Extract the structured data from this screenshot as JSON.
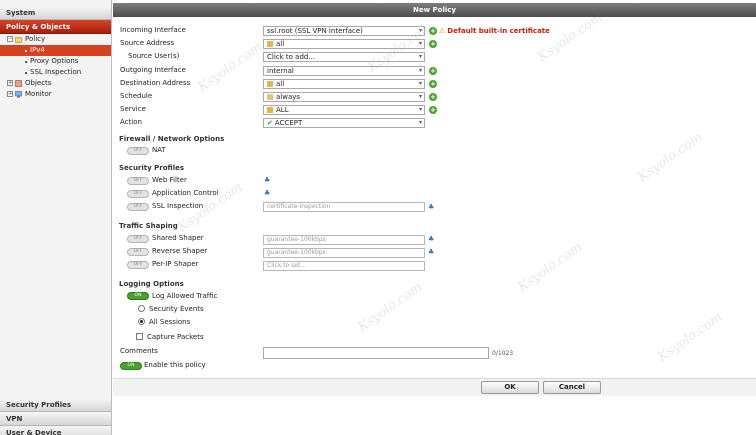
{
  "sidebar": {
    "system": "System",
    "policy_objects": "Policy & Objects",
    "tree": {
      "policy": "Policy",
      "ipv4": "IPv4",
      "proxy_options": "Proxy Options",
      "ssl_inspection": "SSL Inspection",
      "objects": "Objects",
      "monitor": "Monitor"
    },
    "security_profiles": "Security Profiles",
    "vpn": "VPN",
    "user_device": "User & Device"
  },
  "dialog": {
    "title": "New Policy",
    "fields": {
      "incoming_interface": {
        "label": "Incoming Interface",
        "value": "ssl.root (SSL VPN interface)",
        "warning": "Default built-in certificate"
      },
      "source_address": {
        "label": "Source Address",
        "value": "all"
      },
      "source_users": {
        "label": "Source User(s)",
        "value": "Click to add..."
      },
      "outgoing_interface": {
        "label": "Outgoing Interface",
        "value": "internal"
      },
      "destination_address": {
        "label": "Destination Address",
        "value": "all"
      },
      "schedule": {
        "label": "Schedule",
        "value": "always"
      },
      "service": {
        "label": "Service",
        "value": "ALL"
      },
      "action": {
        "label": "Action",
        "value": "ACCEPT"
      }
    },
    "firewall": {
      "title": "Firewall / Network Options",
      "nat": {
        "label": "NAT",
        "state": "OFF"
      }
    },
    "security_profiles": {
      "title": "Security Profiles",
      "web_filter": {
        "label": "Web Filter",
        "state": "OFF"
      },
      "application_control": {
        "label": "Application Control",
        "state": "OFF"
      },
      "ssl_inspection": {
        "label": "SSL Inspection",
        "state": "OFF",
        "value": "certificate-inspection"
      }
    },
    "traffic_shaping": {
      "title": "Traffic Shaping",
      "shared_shaper": {
        "label": "Shared Shaper",
        "state": "OFF",
        "value": "guarantee-100kbps"
      },
      "reverse_shaper": {
        "label": "Reverse Shaper",
        "state": "OFF",
        "value": "guarantee-100kbps"
      },
      "per_ip_shaper": {
        "label": "Per-IP Shaper",
        "state": "OFF",
        "value": "Click to set..."
      }
    },
    "logging": {
      "title": "Logging Options",
      "log_allowed": {
        "label": "Log Allowed Traffic",
        "state": "ON"
      },
      "security_events": "Security Events",
      "all_sessions": "All Sessions",
      "capture_packets": "Capture Packets"
    },
    "comments": {
      "label": "Comments",
      "counter": "0/1023"
    },
    "enable_policy": {
      "label": "Enable this policy",
      "state": "ON"
    },
    "buttons": {
      "ok": "OK",
      "cancel": "Cancel"
    }
  },
  "watermark": "Ksyolo.com",
  "colors": {
    "accent_red": "#c0301a",
    "toggle_on": "#4aa12e",
    "warning_red": "#c6210c"
  }
}
